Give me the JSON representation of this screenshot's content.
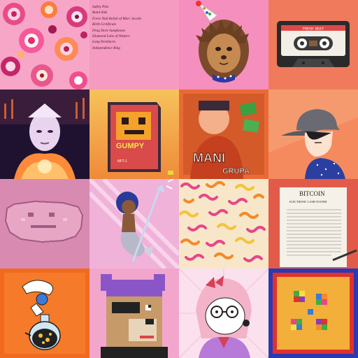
{
  "gallery": {
    "tiles": [
      {
        "name": "psychedelic-flower-pattern"
      },
      {
        "name": "item-list",
        "items": [
          "Safety Pins",
          "Band Aids",
          "Force Null Relish of Marc Jacobs",
          "Birth Certificate",
          "Drug Store Sunglasses",
          "Diamond Lobe of Winters",
          "Long Necklaces",
          "Independence Ring"
        ]
      },
      {
        "name": "party-hedgehog"
      },
      {
        "name": "cassette-tape",
        "label": "FRESH BEAT"
      },
      {
        "name": "glowing-figure-portrait"
      },
      {
        "name": "gumpy-cartridge",
        "title": "GUMPY",
        "subtitle": "NFT-1"
      },
      {
        "name": "mani-grupa-poster",
        "line1": "MANI",
        "line2": "GRUPA"
      },
      {
        "name": "capped-boy-portrait"
      },
      {
        "name": "pixel-pink-blob"
      },
      {
        "name": "mermaid-with-trident"
      },
      {
        "name": "squiggle-pattern"
      },
      {
        "name": "bitcoin-whitepaper",
        "title": "BITCOIN",
        "subtitle": "ELECTRONIC CASH SYSTEM"
      },
      {
        "name": "smurf-potion"
      },
      {
        "name": "pixel-wolf-eyepatch"
      },
      {
        "name": "opossum-girl-glasses"
      },
      {
        "name": "rainbow-pixel-frame"
      }
    ]
  },
  "colors": {
    "pink": "#f08ab5",
    "orange": "#f26a1f",
    "coral": "#f6795a",
    "purple": "#8a56c7"
  }
}
